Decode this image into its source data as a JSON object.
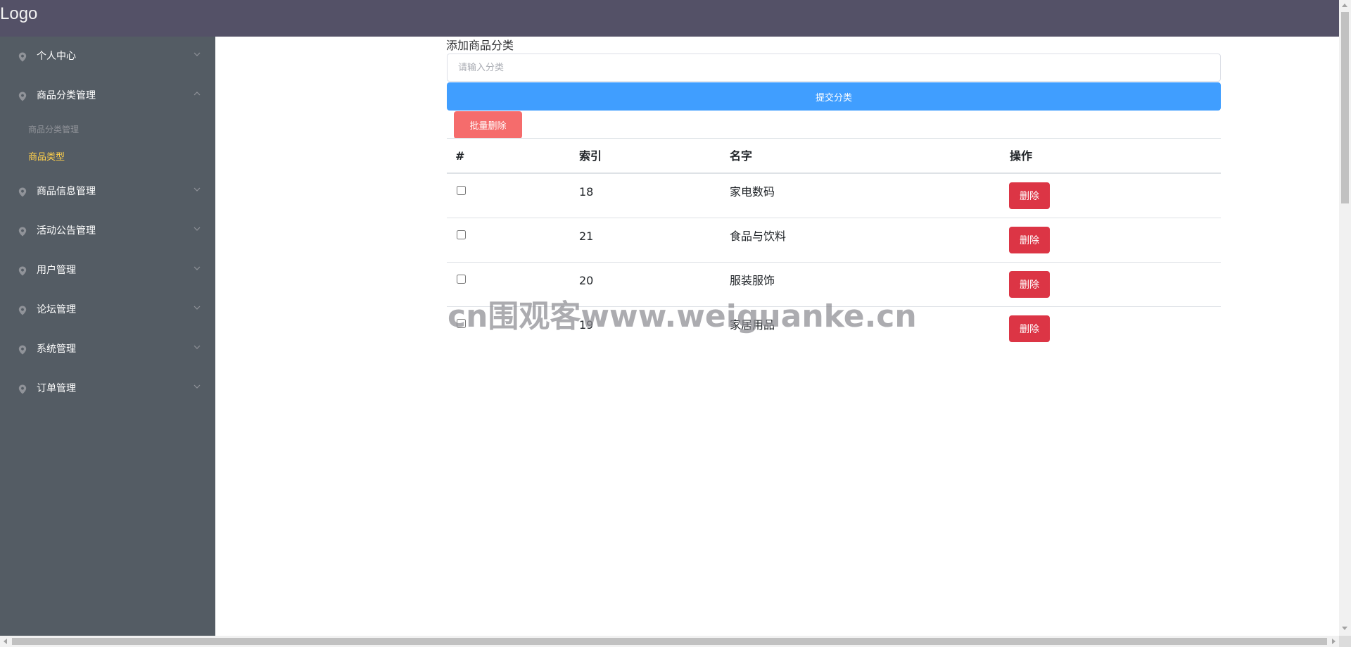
{
  "header": {
    "logo": "Logo"
  },
  "sidebar": {
    "items": [
      {
        "label": "个人中心",
        "expanded": false
      },
      {
        "label": "商品分类管理",
        "expanded": true,
        "children": [
          {
            "label": "商品分类管理",
            "active": false
          },
          {
            "label": "商品类型",
            "active": true
          }
        ]
      },
      {
        "label": "商品信息管理",
        "expanded": false
      },
      {
        "label": "活动公告管理",
        "expanded": false
      },
      {
        "label": "用户管理",
        "expanded": false
      },
      {
        "label": "论坛管理",
        "expanded": false
      },
      {
        "label": "系统管理",
        "expanded": false
      },
      {
        "label": "订单管理",
        "expanded": false
      }
    ],
    "colors": {
      "background": "#545c64",
      "text": "#ffffff",
      "submenu_text": "#909399",
      "active_text": "#ffd04b"
    }
  },
  "form": {
    "title": "添加商品分类",
    "input_placeholder": "请输入分类",
    "input_value": "",
    "submit_label": "提交分类",
    "batch_delete_label": "批量删除"
  },
  "table": {
    "headers": [
      "#",
      "索引",
      "名字",
      "操作"
    ],
    "rows": [
      {
        "checked": false,
        "index": "18",
        "name": "家电数码",
        "action": "删除"
      },
      {
        "checked": false,
        "index": "21",
        "name": "食品与饮料",
        "action": "删除"
      },
      {
        "checked": false,
        "index": "20",
        "name": "服装服饰",
        "action": "删除"
      },
      {
        "checked": false,
        "index": "19",
        "name": "家居用品",
        "action": "删除"
      }
    ]
  },
  "watermark": "cn围观客www.weiguanke.cn",
  "colors": {
    "topbar": "#545167",
    "primary": "#409eff",
    "danger_light": "#f56c6c",
    "danger": "#dc3545"
  }
}
